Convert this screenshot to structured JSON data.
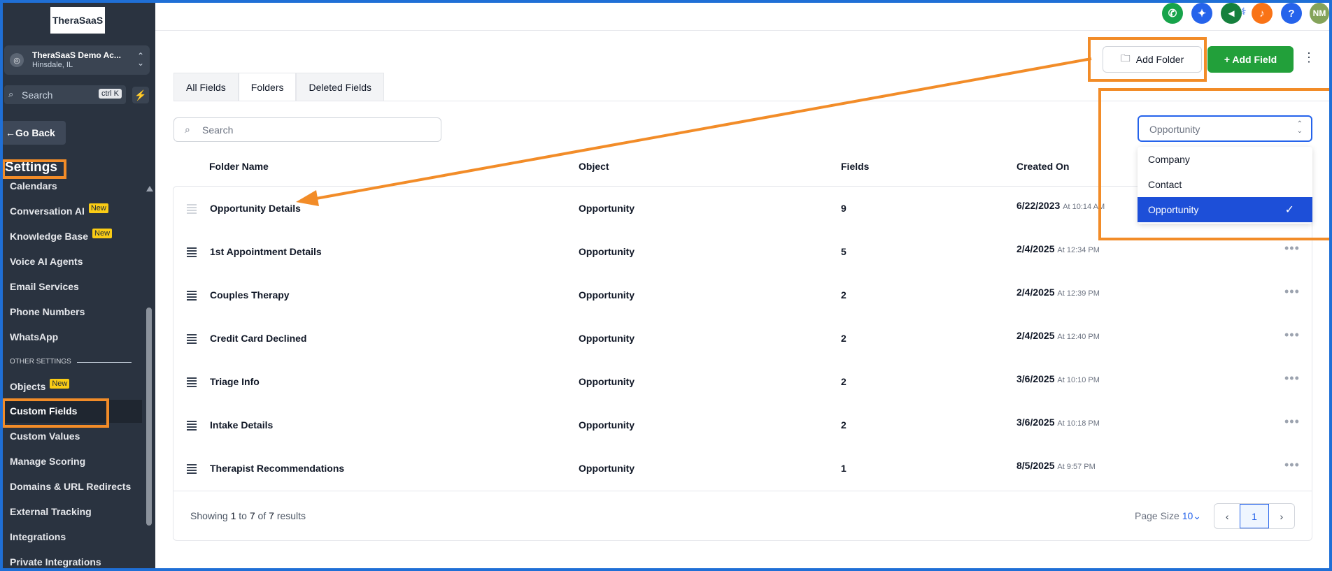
{
  "sidebar": {
    "logo": "TheraSaaS",
    "account_name": "TheraSaaS Demo Ac...",
    "account_location": "Hinsdale, IL",
    "search_placeholder": "Search",
    "search_shortcut": "ctrl K",
    "go_back": "Go Back",
    "section_title": "Settings",
    "items": [
      {
        "label": "Calendars",
        "badge": ""
      },
      {
        "label": "Conversation AI",
        "badge": "New"
      },
      {
        "label": "Knowledge Base",
        "badge": "New"
      },
      {
        "label": "Voice AI Agents",
        "badge": ""
      },
      {
        "label": "Email Services",
        "badge": ""
      },
      {
        "label": "Phone Numbers",
        "badge": ""
      },
      {
        "label": "WhatsApp",
        "badge": ""
      }
    ],
    "other_settings_label": "OTHER SETTINGS",
    "other_items": [
      {
        "label": "Objects",
        "badge": "New"
      },
      {
        "label": "Custom Fields",
        "badge": "",
        "active": true
      },
      {
        "label": "Custom Values",
        "badge": ""
      },
      {
        "label": "Manage Scoring",
        "badge": ""
      },
      {
        "label": "Domains & URL Redirects",
        "badge": ""
      },
      {
        "label": "External Tracking",
        "badge": ""
      },
      {
        "label": "Integrations",
        "badge": ""
      },
      {
        "label": "Private Integrations",
        "badge": ""
      }
    ]
  },
  "topbar": {
    "avatar_initials": "NM",
    "icons": [
      "phone-icon",
      "sparkle-icon",
      "megaphone-icon",
      "bell-icon",
      "help-icon"
    ],
    "icon_colors": [
      "#16a34a",
      "#2563eb",
      "#15803d",
      "#f97316",
      "#2563eb"
    ]
  },
  "header": {
    "add_folder": "Add Folder",
    "add_field": "+ Add Field"
  },
  "tabs": [
    {
      "label": "All Fields"
    },
    {
      "label": "Folders",
      "active": true
    },
    {
      "label": "Deleted Fields"
    }
  ],
  "search": {
    "placeholder": "Search"
  },
  "object_filter": {
    "value": "Opportunity",
    "options": [
      "Company",
      "Contact",
      "Opportunity"
    ],
    "selected": "Opportunity"
  },
  "table": {
    "columns": [
      "Folder Name",
      "Object",
      "Fields",
      "Created On"
    ],
    "rows": [
      {
        "name": "Opportunity Details",
        "object": "Opportunity",
        "fields": "9",
        "date": "6/22/2023",
        "time": "At 10:14 AM"
      },
      {
        "name": "1st Appointment Details",
        "object": "Opportunity",
        "fields": "5",
        "date": "2/4/2025",
        "time": "At 12:34 PM"
      },
      {
        "name": "Couples Therapy",
        "object": "Opportunity",
        "fields": "2",
        "date": "2/4/2025",
        "time": "At 12:39 PM"
      },
      {
        "name": "Credit Card Declined",
        "object": "Opportunity",
        "fields": "2",
        "date": "2/4/2025",
        "time": "At 12:40 PM"
      },
      {
        "name": "Triage Info",
        "object": "Opportunity",
        "fields": "2",
        "date": "3/6/2025",
        "time": "At 10:10 PM"
      },
      {
        "name": "Intake Details",
        "object": "Opportunity",
        "fields": "2",
        "date": "3/6/2025",
        "time": "At 10:18 PM"
      },
      {
        "name": "Therapist Recommendations",
        "object": "Opportunity",
        "fields": "1",
        "date": "8/5/2025",
        "time": "At 9:57 PM"
      }
    ]
  },
  "footer": {
    "showing_prefix": "Showing",
    "from": "1",
    "to_word": "to",
    "to": "7",
    "of_word": "of",
    "total": "7",
    "suffix": "results",
    "page_size_label": "Page Size",
    "page_size_value": "10",
    "current_page": "1"
  },
  "colors": {
    "sidebar_bg": "#2a3340",
    "accent_blue": "#2563eb",
    "add_field_green": "#22a03a",
    "annotation_orange": "#f28c28",
    "frame_blue": "#1f6fd6"
  }
}
